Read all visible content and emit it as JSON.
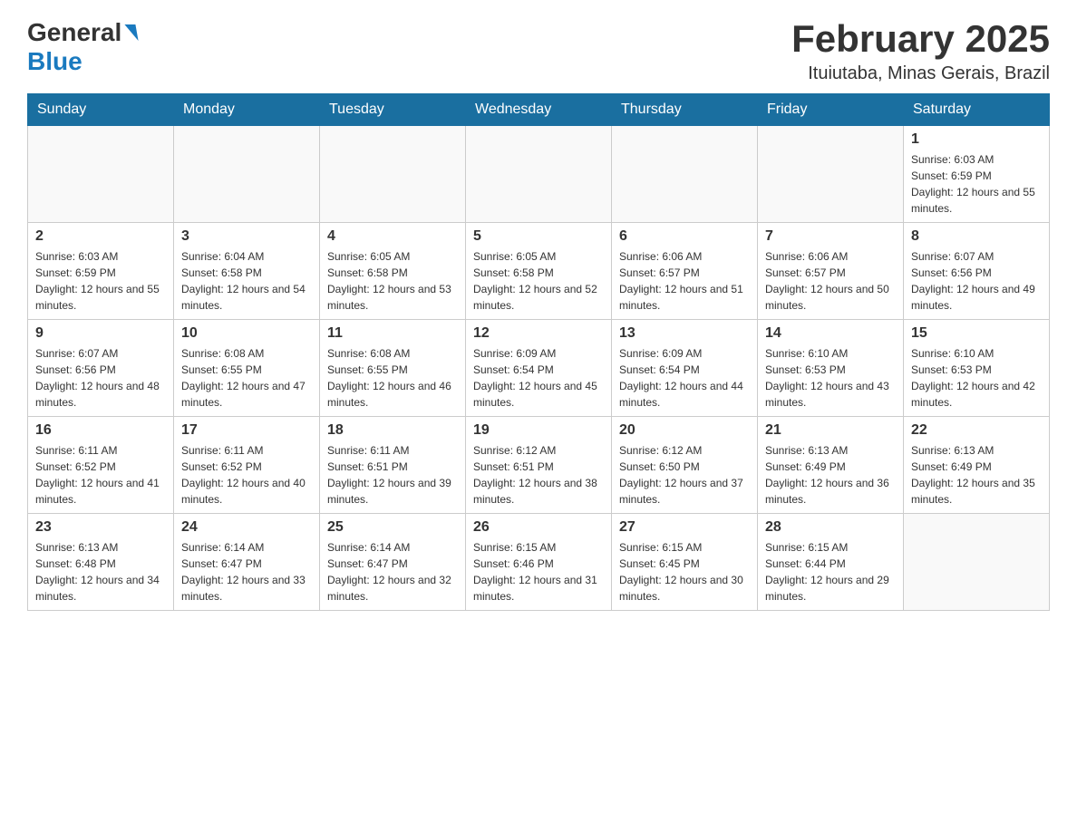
{
  "header": {
    "logo_general": "General",
    "logo_blue": "Blue",
    "title": "February 2025",
    "subtitle": "Ituiutaba, Minas Gerais, Brazil"
  },
  "days_of_week": [
    "Sunday",
    "Monday",
    "Tuesday",
    "Wednesday",
    "Thursday",
    "Friday",
    "Saturday"
  ],
  "weeks": [
    [
      {
        "day": "",
        "sunrise": "",
        "sunset": "",
        "daylight": ""
      },
      {
        "day": "",
        "sunrise": "",
        "sunset": "",
        "daylight": ""
      },
      {
        "day": "",
        "sunrise": "",
        "sunset": "",
        "daylight": ""
      },
      {
        "day": "",
        "sunrise": "",
        "sunset": "",
        "daylight": ""
      },
      {
        "day": "",
        "sunrise": "",
        "sunset": "",
        "daylight": ""
      },
      {
        "day": "",
        "sunrise": "",
        "sunset": "",
        "daylight": ""
      },
      {
        "day": "1",
        "sunrise": "Sunrise: 6:03 AM",
        "sunset": "Sunset: 6:59 PM",
        "daylight": "Daylight: 12 hours and 55 minutes."
      }
    ],
    [
      {
        "day": "2",
        "sunrise": "Sunrise: 6:03 AM",
        "sunset": "Sunset: 6:59 PM",
        "daylight": "Daylight: 12 hours and 55 minutes."
      },
      {
        "day": "3",
        "sunrise": "Sunrise: 6:04 AM",
        "sunset": "Sunset: 6:58 PM",
        "daylight": "Daylight: 12 hours and 54 minutes."
      },
      {
        "day": "4",
        "sunrise": "Sunrise: 6:05 AM",
        "sunset": "Sunset: 6:58 PM",
        "daylight": "Daylight: 12 hours and 53 minutes."
      },
      {
        "day": "5",
        "sunrise": "Sunrise: 6:05 AM",
        "sunset": "Sunset: 6:58 PM",
        "daylight": "Daylight: 12 hours and 52 minutes."
      },
      {
        "day": "6",
        "sunrise": "Sunrise: 6:06 AM",
        "sunset": "Sunset: 6:57 PM",
        "daylight": "Daylight: 12 hours and 51 minutes."
      },
      {
        "day": "7",
        "sunrise": "Sunrise: 6:06 AM",
        "sunset": "Sunset: 6:57 PM",
        "daylight": "Daylight: 12 hours and 50 minutes."
      },
      {
        "day": "8",
        "sunrise": "Sunrise: 6:07 AM",
        "sunset": "Sunset: 6:56 PM",
        "daylight": "Daylight: 12 hours and 49 minutes."
      }
    ],
    [
      {
        "day": "9",
        "sunrise": "Sunrise: 6:07 AM",
        "sunset": "Sunset: 6:56 PM",
        "daylight": "Daylight: 12 hours and 48 minutes."
      },
      {
        "day": "10",
        "sunrise": "Sunrise: 6:08 AM",
        "sunset": "Sunset: 6:55 PM",
        "daylight": "Daylight: 12 hours and 47 minutes."
      },
      {
        "day": "11",
        "sunrise": "Sunrise: 6:08 AM",
        "sunset": "Sunset: 6:55 PM",
        "daylight": "Daylight: 12 hours and 46 minutes."
      },
      {
        "day": "12",
        "sunrise": "Sunrise: 6:09 AM",
        "sunset": "Sunset: 6:54 PM",
        "daylight": "Daylight: 12 hours and 45 minutes."
      },
      {
        "day": "13",
        "sunrise": "Sunrise: 6:09 AM",
        "sunset": "Sunset: 6:54 PM",
        "daylight": "Daylight: 12 hours and 44 minutes."
      },
      {
        "day": "14",
        "sunrise": "Sunrise: 6:10 AM",
        "sunset": "Sunset: 6:53 PM",
        "daylight": "Daylight: 12 hours and 43 minutes."
      },
      {
        "day": "15",
        "sunrise": "Sunrise: 6:10 AM",
        "sunset": "Sunset: 6:53 PM",
        "daylight": "Daylight: 12 hours and 42 minutes."
      }
    ],
    [
      {
        "day": "16",
        "sunrise": "Sunrise: 6:11 AM",
        "sunset": "Sunset: 6:52 PM",
        "daylight": "Daylight: 12 hours and 41 minutes."
      },
      {
        "day": "17",
        "sunrise": "Sunrise: 6:11 AM",
        "sunset": "Sunset: 6:52 PM",
        "daylight": "Daylight: 12 hours and 40 minutes."
      },
      {
        "day": "18",
        "sunrise": "Sunrise: 6:11 AM",
        "sunset": "Sunset: 6:51 PM",
        "daylight": "Daylight: 12 hours and 39 minutes."
      },
      {
        "day": "19",
        "sunrise": "Sunrise: 6:12 AM",
        "sunset": "Sunset: 6:51 PM",
        "daylight": "Daylight: 12 hours and 38 minutes."
      },
      {
        "day": "20",
        "sunrise": "Sunrise: 6:12 AM",
        "sunset": "Sunset: 6:50 PM",
        "daylight": "Daylight: 12 hours and 37 minutes."
      },
      {
        "day": "21",
        "sunrise": "Sunrise: 6:13 AM",
        "sunset": "Sunset: 6:49 PM",
        "daylight": "Daylight: 12 hours and 36 minutes."
      },
      {
        "day": "22",
        "sunrise": "Sunrise: 6:13 AM",
        "sunset": "Sunset: 6:49 PM",
        "daylight": "Daylight: 12 hours and 35 minutes."
      }
    ],
    [
      {
        "day": "23",
        "sunrise": "Sunrise: 6:13 AM",
        "sunset": "Sunset: 6:48 PM",
        "daylight": "Daylight: 12 hours and 34 minutes."
      },
      {
        "day": "24",
        "sunrise": "Sunrise: 6:14 AM",
        "sunset": "Sunset: 6:47 PM",
        "daylight": "Daylight: 12 hours and 33 minutes."
      },
      {
        "day": "25",
        "sunrise": "Sunrise: 6:14 AM",
        "sunset": "Sunset: 6:47 PM",
        "daylight": "Daylight: 12 hours and 32 minutes."
      },
      {
        "day": "26",
        "sunrise": "Sunrise: 6:15 AM",
        "sunset": "Sunset: 6:46 PM",
        "daylight": "Daylight: 12 hours and 31 minutes."
      },
      {
        "day": "27",
        "sunrise": "Sunrise: 6:15 AM",
        "sunset": "Sunset: 6:45 PM",
        "daylight": "Daylight: 12 hours and 30 minutes."
      },
      {
        "day": "28",
        "sunrise": "Sunrise: 6:15 AM",
        "sunset": "Sunset: 6:44 PM",
        "daylight": "Daylight: 12 hours and 29 minutes."
      },
      {
        "day": "",
        "sunrise": "",
        "sunset": "",
        "daylight": ""
      }
    ]
  ]
}
